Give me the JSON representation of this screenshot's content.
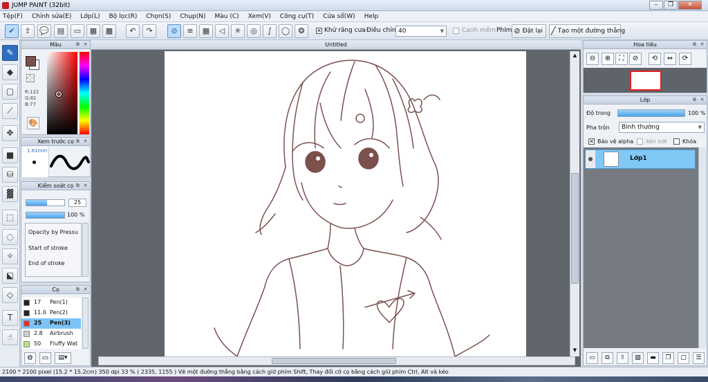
{
  "titlebar": {
    "title": "JUMP PAINT (32bit)"
  },
  "menu": [
    "Tệp(F)",
    "Chỉnh sửa(E)",
    "Lớp(L)",
    "Bộ lọc(R)",
    "Chọn(S)",
    "Chụp(N)",
    "Màu (C)",
    "Xem(V)",
    "Công cụ(T)",
    "Cửa sổ(W)",
    "Help"
  ],
  "toolbar": {
    "antialias_label": "Khử răng cưa",
    "adjust_label": "Điều chỉnh",
    "adjust_value": "40",
    "edge_label": "Cạnh mềm",
    "key_label": "Phím",
    "reset_label": "Đặt lại",
    "line_label": "Tạo một đường thẳng"
  },
  "color_panel": {
    "title": "Màu",
    "r": "R:122",
    "g": "G:81",
    "b": "B:77",
    "main_color": "#7a514d"
  },
  "brush_preview": {
    "title": "Xem trước cọ",
    "size": "1.81mm"
  },
  "brush_control": {
    "title": "Kiểm soát cọ",
    "size_value": "25",
    "size_fraction": 0.55,
    "opacity_value": "100 %",
    "opacity_fraction": 1.0,
    "opacity_pressure": "Opacity by Pressu",
    "start_stroke": "Start of stroke",
    "end_stroke": "End of stroke"
  },
  "brush_list": {
    "title": "Cọ",
    "items": [
      {
        "size": "17",
        "name": "Pen(1)",
        "color": "#222222"
      },
      {
        "size": "11.0",
        "name": "Pen(2)",
        "color": "#222222"
      },
      {
        "size": "25",
        "name": "Pen(3)",
        "color": "#e03030"
      },
      {
        "size": "2.8",
        "name": "Airbrush",
        "color": "#cccccc"
      },
      {
        "size": "50",
        "name": "Fluffy Wat",
        "color": "#b8e08a"
      }
    ],
    "selected_index": 2
  },
  "document": {
    "tab_title": "Untitled"
  },
  "navigator": {
    "title": "Hoa tiêu"
  },
  "layers": {
    "title": "Lớp",
    "opacity_label": "Độ trong",
    "opacity_value": "100 %",
    "opacity_fraction": 1.0,
    "blend_label": "Pha trộn",
    "blend_value": "Bình thường",
    "protect_alpha": "Bảo vệ alpha",
    "clip": "Xén bớt",
    "lock": "Khóa",
    "layer_name": "Lớp1"
  },
  "status": {
    "text": "2100 * 2100 pixel  (15.2 * 15.2cm)  350 dpi  33 %  ( 2335, 1155 )  Vẽ một đường thẳng bằng cách giữ phím Shift, Thay đổi cỡ cọ bằng cách giữ phím Ctrl, Alt và kéo"
  }
}
